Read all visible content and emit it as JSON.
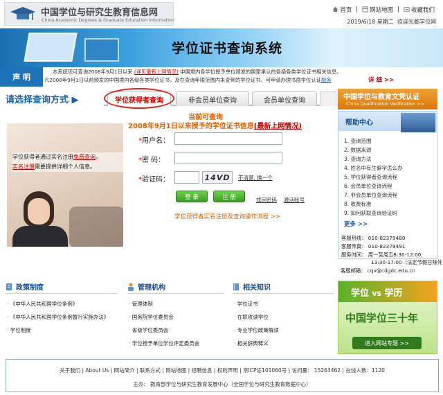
{
  "header": {
    "logo_cn": "中国学位与研究生教育信息网",
    "logo_en": "China Academic Degrees & Graduate Education Information",
    "links": [
      "首页",
      "网站地图",
      "收藏我们"
    ],
    "date": "2019/6/18 星期二",
    "welcome": "欢迎光临学位网"
  },
  "banner": {
    "title": "学位证书查询系统"
  },
  "notice": {
    "label": "声 明",
    "line1_a": "本系统现可查询2008年9月1日以来",
    "line1_link": "(详见最新上网情况)",
    "line1_b": "中国境内各学位授予单位颁发的国家承认的各级各类学位证书相关信息。",
    "line2_a": "凡2008年9月1日以前颁发的中国境内各级各类学位证书，及在查询年限范围内未查到的学位证书，可申请办理书面学位认证",
    "line2_link": "服务",
    "detail": "详 细 >>"
  },
  "tabs": {
    "heading": "请选择查询方式",
    "items": [
      "学位获得者查询",
      "非会员单位查询",
      "会员单位查询"
    ]
  },
  "query": {
    "head1": "当前可查询",
    "head2_a": "2008年9月1日以来授予的学位证书信息",
    "head2_link": "(最新上网情况)",
    "intro_a": "学位获得者通过实名注册",
    "intro_link": "免费查询",
    "intro_b": "。",
    "intro_link2": "实名注册",
    "intro_c": "需要提供详细个人信息。",
    "username_label": "用户名：",
    "password_label": "密  码：",
    "captcha_label": "验证码：",
    "captcha_text": "14VD",
    "cant_see": "不清楚, 换一个",
    "login_btn": "登 录",
    "register_btn": "注 册",
    "forgot": "找回密码",
    "activate": "激活账号",
    "flow": "学位获得者实名注册及查询操作流程 >>"
  },
  "right": {
    "qcv_cn": "中国学位与教育文凭认证",
    "qcv_en": "China Qualification Verification >>",
    "help_title": "帮助中心",
    "help_items": [
      "查询范围",
      "数据来源",
      "查询方法",
      "姓名中有生僻字怎么办",
      "学位获得者查询流程",
      "会员单位查询流程",
      "非会员单位查询流程",
      "收费标准",
      "如何获取查询验证码"
    ],
    "more": "更多 >>",
    "contacts": [
      "客服热线：  010-82379480",
      "客服传真：  010-82379491",
      "服务时间：  周一至周五8:30-12:00,",
      "13:30-17:00（法定节假日除外）",
      "客服邮箱：  cqv@cdgdc.edu.cn"
    ]
  },
  "sections": {
    "policy": {
      "title": "政策制度",
      "items": [
        "《中华人民共和国学位条例》",
        "《中华人民共和国学位条例暂行实施办法》",
        "学位制度"
      ]
    },
    "org": {
      "title": "管理机构",
      "items": [
        "管理体制",
        "国务院学位委员会",
        "省级学位委员会",
        "学位授予单位学位评定委员会"
      ]
    },
    "knowledge": {
      "title": "相关知识",
      "items": [
        "学位证书",
        "在职攻读学位",
        "专业学位政策解读",
        "相关辞典释义"
      ]
    }
  },
  "ad": {
    "vs_a": "学位",
    "vs_mid": "VS",
    "vs_b": "学历",
    "mid": "中国学位三十年",
    "bottom": "进入网站专题 >>"
  },
  "footer": {
    "line1": "关于我们 | About Us | 网站简介 | 联系方式 | 网站地图 | 招聘信息 | 权利声明 | 京ICP证101060号 | 访问量： 15263462 | 在线人数：1120",
    "line2": "主办： 教育部学位与研究生教育发展中心（全国学位与研究生教育数据中心）"
  },
  "colors": {
    "brand_blue": "#1e72b8",
    "tab_active": "#cc0000",
    "orange": "#e06000",
    "green_button": "#3b9e22"
  }
}
